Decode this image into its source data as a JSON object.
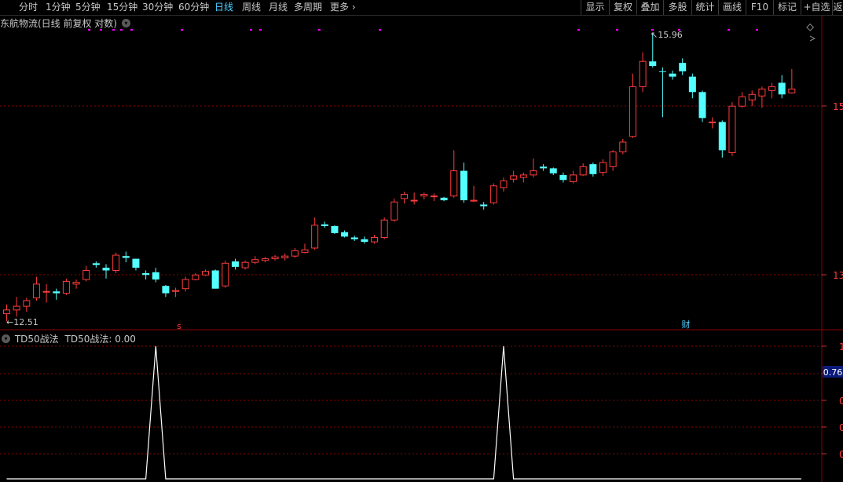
{
  "toolbar": {
    "periods": [
      "分时",
      "1分钟",
      "5分钟",
      "15分钟",
      "30分钟",
      "60分钟",
      "日线",
      "周线",
      "月线",
      "多周期",
      "更多"
    ],
    "active": "日线",
    "right_buttons": [
      "显示",
      "复权",
      "叠加",
      "多股",
      "统计",
      "画线",
      "F10",
      "标记",
      "+自选",
      "返"
    ]
  },
  "main": {
    "title": "东航物流(日线 前复权 对数)",
    "high_label": "15.96",
    "low_label": "12.51",
    "price_axis": [
      "15",
      "13"
    ],
    "marker_s": "s",
    "marker_cai": "财"
  },
  "indicator": {
    "name": "TD50战法",
    "value_text": "TD50战法: 0.00",
    "axis": [
      "1",
      "0",
      "0",
      "0",
      "0"
    ],
    "current_value": "0.76",
    "spikes_at_candle": [
      15,
      50
    ]
  },
  "colors": {
    "up": "#ff3c3c",
    "down": "#54ffff",
    "bg": "#000000",
    "grid": "#8b0000",
    "accent": "#4fd0ff",
    "magenta": "#ff00ff"
  },
  "chart_data": {
    "type": "candlestick",
    "ohlc": [
      [
        12.58,
        12.68,
        12.5,
        12.62
      ],
      [
        12.62,
        12.76,
        12.55,
        12.66
      ],
      [
        12.66,
        12.75,
        12.6,
        12.72
      ],
      [
        12.75,
        12.98,
        12.72,
        12.9
      ],
      [
        12.82,
        12.9,
        12.7,
        12.82
      ],
      [
        12.82,
        12.85,
        12.73,
        12.8
      ],
      [
        12.8,
        12.96,
        12.78,
        12.93
      ],
      [
        12.9,
        12.95,
        12.85,
        12.92
      ],
      [
        12.95,
        13.1,
        12.93,
        13.05
      ],
      [
        13.13,
        13.15,
        13.08,
        13.11
      ],
      [
        13.08,
        13.12,
        12.96,
        13.05
      ],
      [
        13.05,
        13.25,
        13.02,
        13.22
      ],
      [
        13.21,
        13.26,
        13.14,
        13.19
      ],
      [
        13.18,
        13.18,
        13.05,
        13.08
      ],
      [
        13.02,
        13.05,
        12.95,
        13.0
      ],
      [
        13.03,
        13.08,
        12.92,
        12.95
      ],
      [
        12.88,
        12.89,
        12.76,
        12.8
      ],
      [
        12.82,
        12.86,
        12.76,
        12.83
      ],
      [
        12.85,
        12.98,
        12.82,
        12.95
      ],
      [
        12.95,
        13.02,
        12.94,
        13.0
      ],
      [
        13.0,
        13.06,
        12.99,
        13.04
      ],
      [
        13.05,
        13.06,
        12.85,
        12.85
      ],
      [
        12.88,
        13.16,
        12.86,
        13.13
      ],
      [
        13.15,
        13.18,
        13.06,
        13.09
      ],
      [
        13.08,
        13.16,
        13.06,
        13.14
      ],
      [
        13.14,
        13.21,
        13.12,
        13.17
      ],
      [
        13.16,
        13.2,
        13.14,
        13.18
      ],
      [
        13.18,
        13.22,
        13.16,
        13.2
      ],
      [
        13.19,
        13.24,
        13.16,
        13.21
      ],
      [
        13.21,
        13.3,
        13.19,
        13.27
      ],
      [
        13.25,
        13.35,
        13.24,
        13.28
      ],
      [
        13.3,
        13.65,
        13.28,
        13.56
      ],
      [
        13.57,
        13.6,
        13.53,
        13.55
      ],
      [
        13.55,
        13.56,
        13.46,
        13.47
      ],
      [
        13.48,
        13.5,
        13.42,
        13.43
      ],
      [
        13.42,
        13.44,
        13.38,
        13.4
      ],
      [
        13.4,
        13.43,
        13.35,
        13.37
      ],
      [
        13.37,
        13.45,
        13.35,
        13.42
      ],
      [
        13.42,
        13.65,
        13.4,
        13.62
      ],
      [
        13.62,
        13.87,
        13.6,
        13.83
      ],
      [
        13.87,
        13.95,
        13.81,
        13.92
      ],
      [
        13.85,
        13.94,
        13.8,
        13.85
      ],
      [
        13.9,
        13.94,
        13.86,
        13.92
      ],
      [
        13.9,
        13.93,
        13.84,
        13.9
      ],
      [
        13.88,
        13.89,
        13.84,
        13.85
      ],
      [
        13.9,
        14.45,
        13.88,
        14.2
      ],
      [
        14.2,
        14.3,
        13.82,
        13.85
      ],
      [
        13.84,
        14.02,
        13.83,
        13.85
      ],
      [
        13.8,
        13.83,
        13.74,
        13.78
      ],
      [
        13.82,
        14.05,
        13.8,
        14.02
      ],
      [
        14.0,
        14.12,
        13.95,
        14.08
      ],
      [
        14.1,
        14.2,
        14.06,
        14.14
      ],
      [
        14.12,
        14.18,
        14.06,
        14.15
      ],
      [
        14.15,
        14.35,
        14.12,
        14.2
      ],
      [
        14.25,
        14.28,
        14.2,
        14.23
      ],
      [
        14.23,
        14.24,
        14.15,
        14.17
      ],
      [
        14.15,
        14.18,
        14.06,
        14.09
      ],
      [
        14.07,
        14.2,
        14.05,
        14.15
      ],
      [
        14.15,
        14.29,
        14.14,
        14.25
      ],
      [
        14.28,
        14.3,
        14.13,
        14.16
      ],
      [
        14.18,
        14.34,
        14.14,
        14.3
      ],
      [
        14.25,
        14.45,
        14.2,
        14.43
      ],
      [
        14.43,
        14.59,
        14.4,
        14.55
      ],
      [
        14.62,
        15.42,
        14.6,
        15.25
      ],
      [
        15.25,
        15.7,
        15.18,
        15.58
      ],
      [
        15.58,
        15.96,
        15.5,
        15.52
      ],
      [
        15.45,
        15.5,
        14.86,
        15.44
      ],
      [
        15.42,
        15.46,
        15.34,
        15.38
      ],
      [
        15.56,
        15.62,
        15.4,
        15.45
      ],
      [
        15.38,
        15.42,
        15.1,
        15.18
      ],
      [
        15.18,
        15.2,
        14.8,
        14.85
      ],
      [
        14.8,
        14.86,
        14.72,
        14.8
      ],
      [
        14.8,
        14.82,
        14.36,
        14.45
      ],
      [
        14.42,
        15.05,
        14.38,
        15.0
      ],
      [
        15.0,
        15.18,
        14.98,
        15.12
      ],
      [
        15.08,
        15.2,
        15.0,
        15.15
      ],
      [
        15.13,
        15.25,
        14.98,
        15.22
      ],
      [
        15.2,
        15.3,
        15.1,
        15.25
      ],
      [
        15.3,
        15.4,
        15.1,
        15.15
      ],
      [
        15.17,
        15.48,
        15.16,
        15.22
      ]
    ]
  }
}
